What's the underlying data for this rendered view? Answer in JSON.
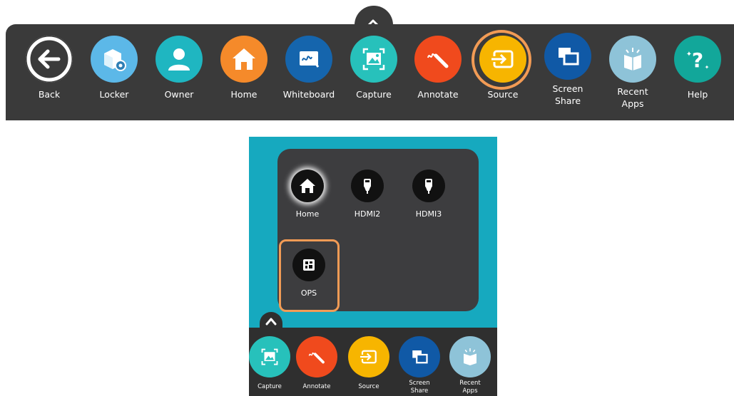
{
  "toolbar": {
    "collapse_icon": "chevron-up-icon",
    "items": [
      {
        "label": "Back",
        "icon": "back-arrow-icon",
        "color": "#ffffff"
      },
      {
        "label": "Locker",
        "icon": "locker-icon",
        "color": "#5cb8e8"
      },
      {
        "label": "Owner",
        "icon": "owner-icon",
        "color": "#1fb6c1"
      },
      {
        "label": "Home",
        "icon": "home-icon",
        "color": "#f58a2a"
      },
      {
        "label": "Whiteboard",
        "icon": "whiteboard-icon",
        "color": "#1565ad"
      },
      {
        "label": "Capture",
        "icon": "capture-icon",
        "color": "#27c1bb"
      },
      {
        "label": "Annotate",
        "icon": "annotate-icon",
        "color": "#f04a1d"
      },
      {
        "label": "Source",
        "icon": "source-icon",
        "color": "#f7b500",
        "highlighted": true
      },
      {
        "label": "Screen\nShare",
        "icon": "screen-share-icon",
        "color": "#1059a6"
      },
      {
        "label": "Recent\nApps",
        "icon": "recent-apps-icon",
        "color": "#8ec3d8"
      },
      {
        "label": "Help",
        "icon": "help-icon",
        "color": "#12a79a"
      }
    ]
  },
  "source_popup": {
    "items": [
      {
        "label": "Home",
        "icon": "home-icon"
      },
      {
        "label": "HDMI2",
        "icon": "hdmi-icon"
      },
      {
        "label": "HDMI3",
        "icon": "hdmi-icon"
      },
      {
        "label": "OPS",
        "icon": "ops-icon",
        "highlighted": true
      }
    ]
  },
  "mini_bar": {
    "items": [
      {
        "label": "Capture",
        "color": "#27c1bb"
      },
      {
        "label": "Annotate",
        "color": "#f04a1d"
      },
      {
        "label": "Source",
        "color": "#f7b500"
      },
      {
        "label": "Screen\nShare",
        "color": "#1059a6"
      },
      {
        "label": "Recent\nApps",
        "color": "#8ec3d8"
      }
    ]
  },
  "colors": {
    "toolbar_bg": "#3a3a3a",
    "highlight_ring": "#f29b55",
    "panel_bg": "#16a9bf"
  }
}
